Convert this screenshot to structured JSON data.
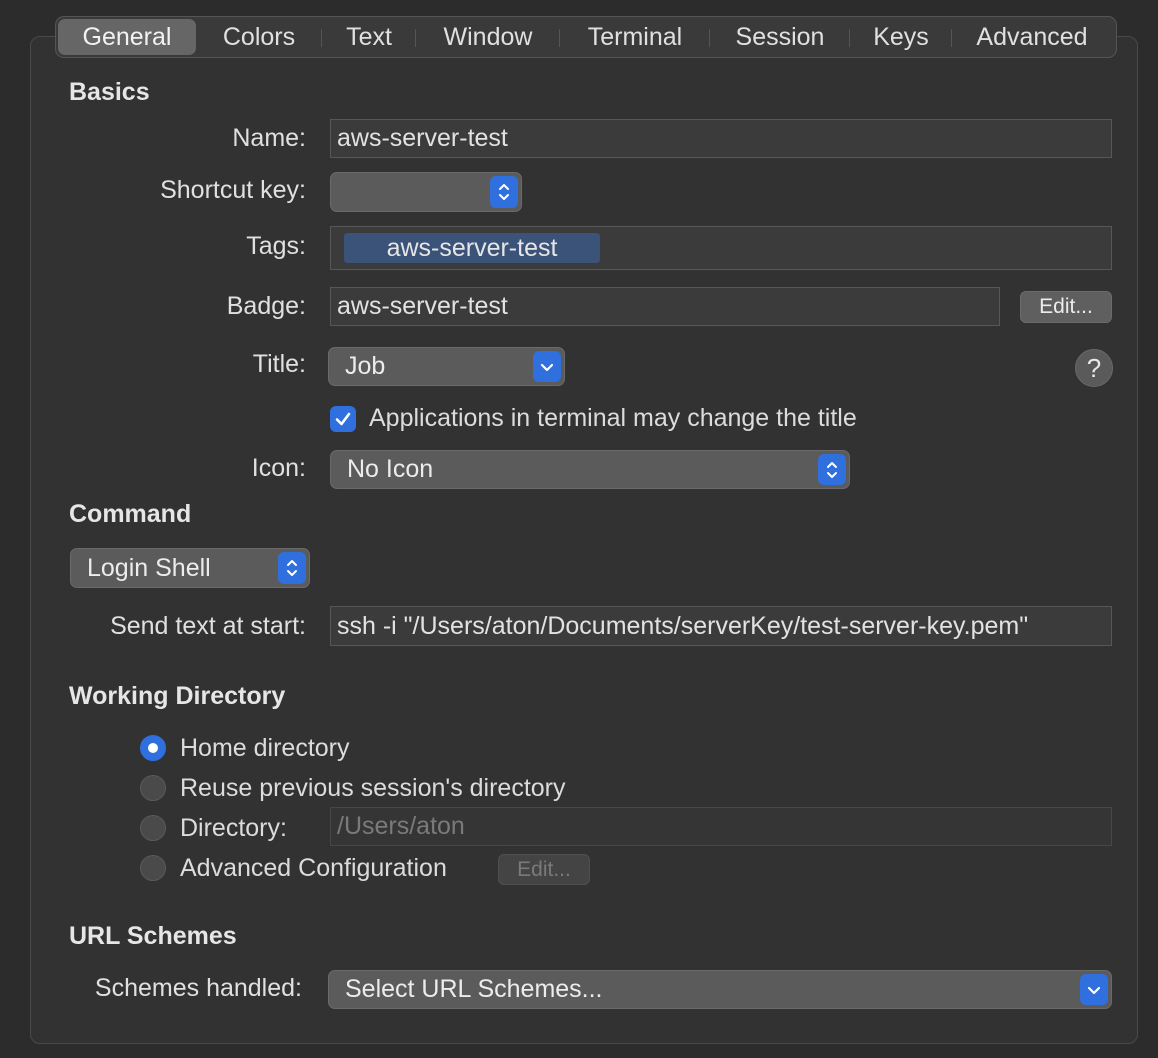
{
  "tabs": [
    "General",
    "Colors",
    "Text",
    "Window",
    "Terminal",
    "Session",
    "Keys",
    "Advanced"
  ],
  "basics": {
    "heading": "Basics",
    "name_label": "Name:",
    "name_value": "aws-server-test",
    "shortcut_label": "Shortcut key:",
    "shortcut_value": "",
    "tags_label": "Tags:",
    "tag": "aws-server-test",
    "badge_label": "Badge:",
    "badge_value": "aws-server-test",
    "badge_edit": "Edit...",
    "title_label": "Title:",
    "title_value": "Job",
    "help": "?",
    "title_checkbox": "Applications in terminal may change the title",
    "title_checkbox_checked": true,
    "icon_label": "Icon:",
    "icon_value": "No Icon"
  },
  "command": {
    "heading": "Command",
    "shell_value": "Login Shell",
    "send_text_label": "Send text at start:",
    "send_text_value": "ssh -i \"/Users/aton/Documents/serverKey/test-server-key.pem\""
  },
  "working_directory": {
    "heading": "Working Directory",
    "options": [
      "Home directory",
      "Reuse previous session's directory",
      "Directory:",
      "Advanced Configuration"
    ],
    "selected": "Home directory",
    "directory_placeholder": "/Users/aton",
    "advanced_edit": "Edit..."
  },
  "url_schemes": {
    "heading": "URL Schemes",
    "schemes_label": "Schemes handled:",
    "schemes_value": "Select URL Schemes..."
  },
  "colors": {
    "accent": "#2f6fde",
    "tag_chip": "#3b5279"
  }
}
